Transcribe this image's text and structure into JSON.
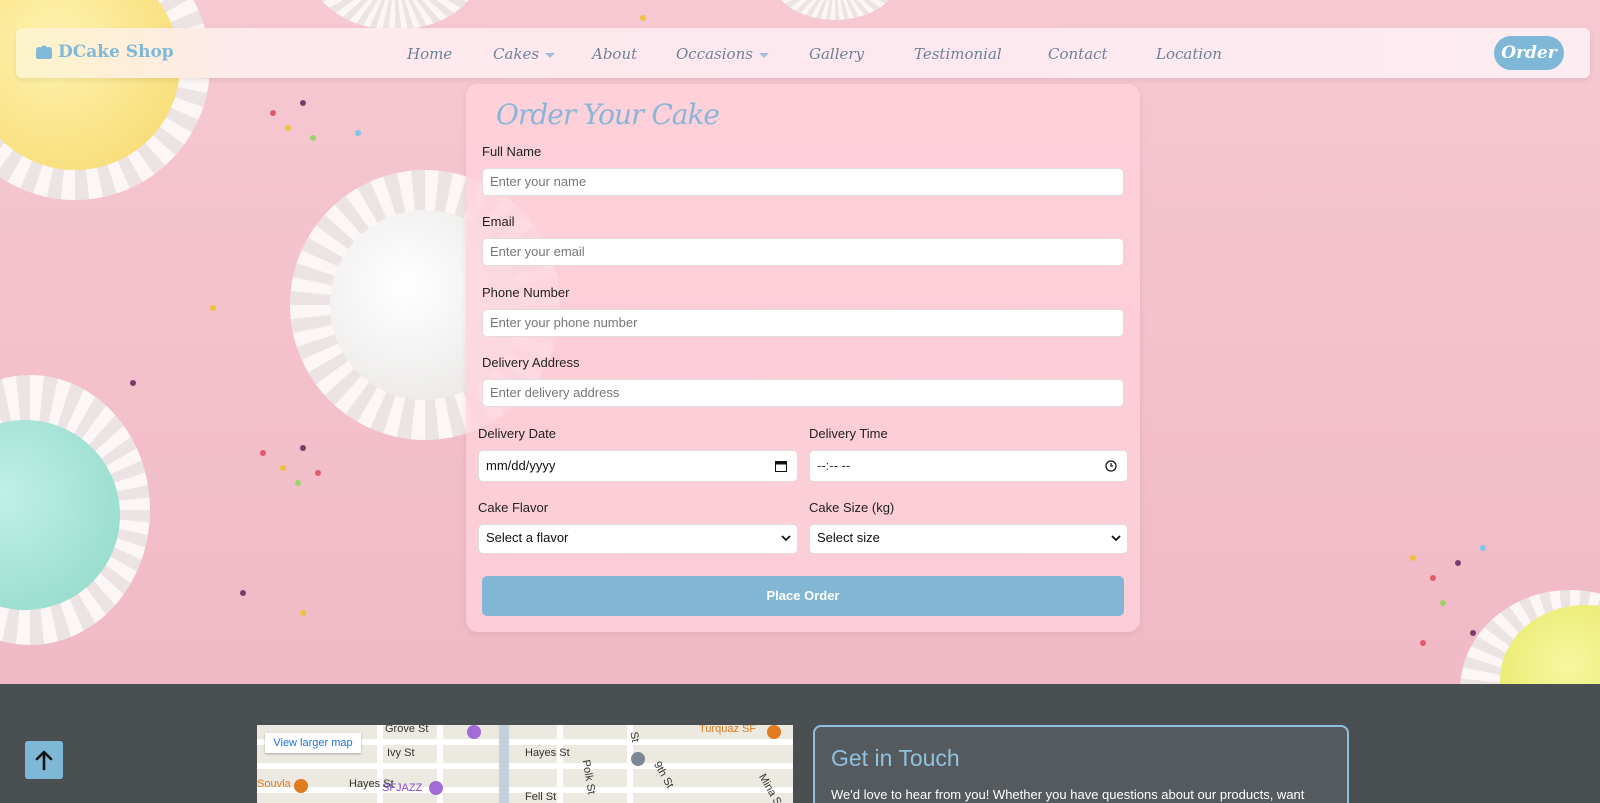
{
  "brand": {
    "name": "DCake Shop",
    "icon": "cake-logo-icon"
  },
  "nav": {
    "items": [
      {
        "label": "Home",
        "dropdown": false
      },
      {
        "label": "Cakes",
        "dropdown": true
      },
      {
        "label": "About",
        "dropdown": false
      },
      {
        "label": "Occasions",
        "dropdown": true
      },
      {
        "label": "Gallery",
        "dropdown": false
      },
      {
        "label": "Testimonial",
        "dropdown": false
      },
      {
        "label": "Contact",
        "dropdown": false
      },
      {
        "label": "Location",
        "dropdown": false
      }
    ],
    "order_label": "Order"
  },
  "form": {
    "title": "Order Your Cake",
    "full_name": {
      "label": "Full Name",
      "placeholder": "Enter your name"
    },
    "email": {
      "label": "Email",
      "placeholder": "Enter your email"
    },
    "phone": {
      "label": "Phone Number",
      "placeholder": "Enter your phone number"
    },
    "address": {
      "label": "Delivery Address",
      "placeholder": "Enter delivery address"
    },
    "date": {
      "label": "Delivery Date",
      "value": "mm/dd/yyyy",
      "icon": "calendar-icon"
    },
    "time": {
      "label": "Delivery Time",
      "value": "--:-- --",
      "icon": "clock-icon"
    },
    "flavor": {
      "label": "Cake Flavor",
      "value": "Select a flavor"
    },
    "size": {
      "label": "Cake Size (kg)",
      "value": "Select size"
    },
    "submit_label": "Place Order"
  },
  "map": {
    "button": "View larger map",
    "labels": [
      "Grove St",
      "Ivy St",
      "Hayes St",
      "Hayes St",
      "Polk St",
      "9th St",
      "Fell St",
      "St",
      "Turquaz SF",
      "Souvla",
      "SFJAZZ",
      "Mina St"
    ]
  },
  "contact": {
    "title": "Get in Touch",
    "text": "We'd love to hear from you! Whether you have questions about our products, want"
  },
  "scroll_top": {
    "icon": "arrow-up-icon"
  },
  "colors": {
    "accent": "#7fb8d6",
    "pink": "#f3bfca",
    "footer": "#4a4f52"
  }
}
